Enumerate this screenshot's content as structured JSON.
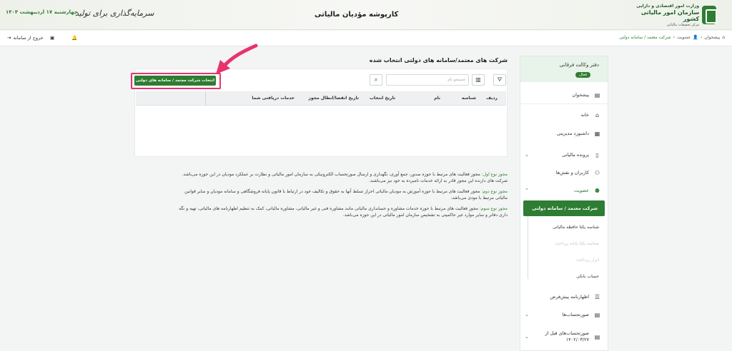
{
  "header": {
    "logo_line1": "وزارت امور اقتصادی و دارایی",
    "logo_line2": "سازمان امور مالیاتی کشور",
    "logo_line3": "مرکز تحقیقات مالیاتی",
    "title": "کارپوشه مؤدیان مالیاتی",
    "slogan": "سرمایه‌گذاری برای تولید",
    "date": "چهارشنبه ۱۷ اردیبهشت ۱۴۰۴"
  },
  "toolbar": {
    "logout": "خروج از سامانه",
    "breadcrumb": [
      "پیشخوان",
      "عضویت",
      "شرکت معتمد / سامانه دولتی"
    ]
  },
  "sidebar": {
    "office_name": "دفتر وکالت فرقانی",
    "office_badge": "فعال",
    "items": [
      {
        "label": "پیشخوان"
      },
      {
        "label": "خانه"
      },
      {
        "label": "داشبورد مدیریتی"
      },
      {
        "label": "پرونده مالیاتی"
      },
      {
        "label": "کاربران و نقش‌ها"
      },
      {
        "label": "عضویت"
      }
    ],
    "active_sub": "شرکت معتمد / سامانه دولتی",
    "subs": [
      {
        "label": "شناسه یکتا حافظه مالیاتی"
      },
      {
        "label": "شناسه یکتا پایانه پرداخت"
      },
      {
        "label": "ابزار پرداخت"
      },
      {
        "label": "حساب بانکی"
      }
    ],
    "items_bottom": [
      {
        "label": "اظهارنامه پیش‌فرض"
      },
      {
        "label": "صورتحساب‌ها"
      },
      {
        "label": "صورتحساب‌های قبل از ۱۴۰۲/۰۳/۲۷"
      }
    ]
  },
  "main": {
    "title": "شرکت های معتمد/سامانه های دولتی انتخاب شده",
    "select_button": "انتخاب شرکت معتمد / سامانه های دولتی",
    "search_placeholder": "جستجو نام",
    "columns": [
      "ردیف",
      "شناسه",
      "نام",
      "تاریخ انتخاب",
      "تاریخ انقضا/ابطال مجوز",
      "خدمات دریافتی شما"
    ]
  },
  "descriptions": {
    "type1_label": "مجوز نوع اول:",
    "type1_text": "مجوز فعالیت های مرتبط با حوزه صدور، جمع آوری، نگهداری و ارسال صورتحساب الکترونیکی به سازمان امور مالیاتی و نظارت بر عملکرد مودیان در این حوزه می‌باشد.",
    "type1_text2": "شرکت های دارنده این مجوز قادر به ارائه خدمات نامبرده به خود نیز می‌باشند.",
    "type2_label": "مجوز نوع دوم:",
    "type2_text": "مجوز فعالیت های مرتبط با حوزه آموزش به مودیان مالیاتی احراز تسلط آنها به حقوق و تکالیف خود در ارتباط با قانون پایانه فروشگاهی و سامانه مودیان و سایر قوانین",
    "type2_text2": "مالیاتی مرتبط با مودی می‌باشد.",
    "type3_label": "مجوز نوع سوم:",
    "type3_text": "مجوز فعالیت های مرتبط با حوزه خدمات مشاوره و حسابداری مالیاتی مانند مشاوره فنی و غیر مالیاتی، مشاوره مالیاتی، کمک به تنظیم اظهارنامه های مالیاتی، تهیه و نگه",
    "type3_text2": "داری دفاتر و سایر موارد غیر حاکمیتی به تشخیص سازمان امور مالیاتی در این حوزه می‌باشد."
  },
  "colors": {
    "brand": "#2e7d32",
    "highlight": "#e8336d"
  }
}
